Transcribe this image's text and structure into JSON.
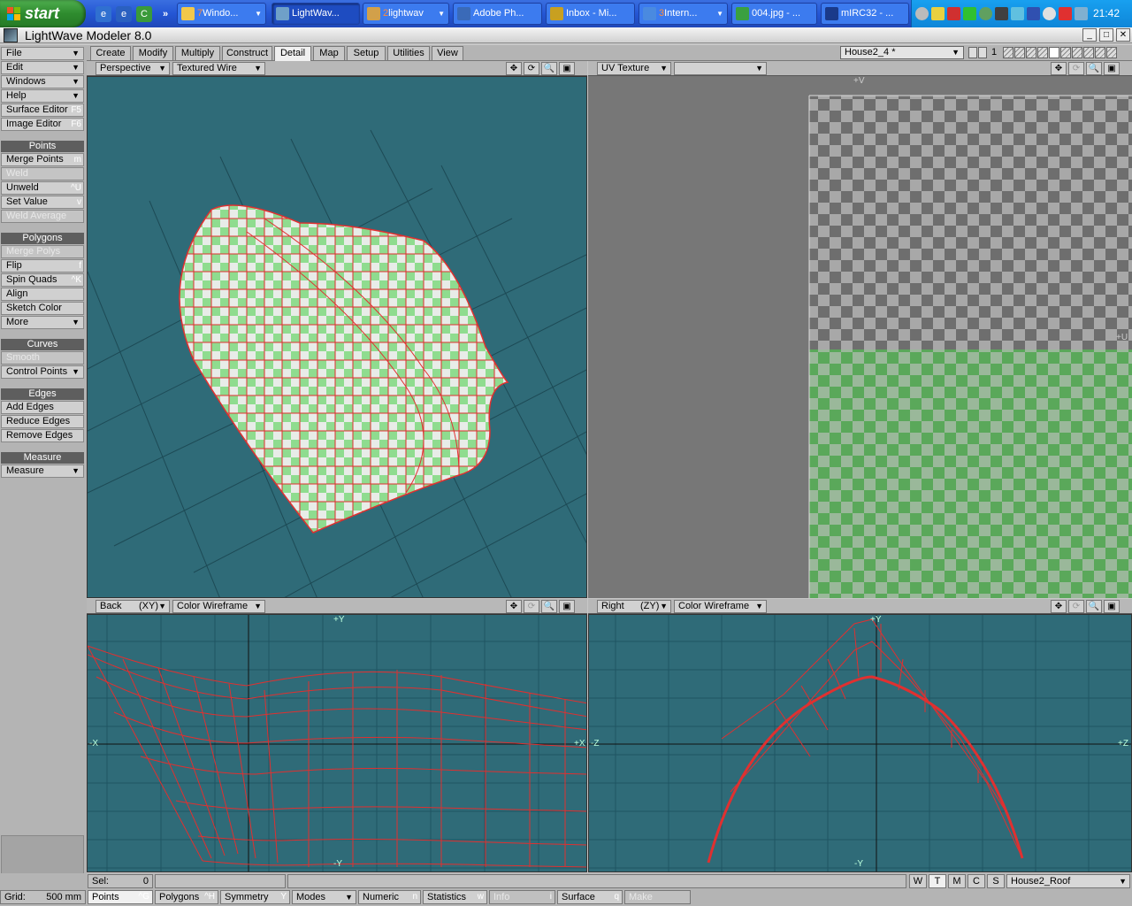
{
  "taskbar": {
    "start_label": "start",
    "buttons": [
      {
        "count": "7",
        "label": "Windo...",
        "icon_color": "#f2c84b"
      },
      {
        "count": "",
        "label": "LightWav...",
        "icon_color": "#6fa0c8"
      },
      {
        "count": "2",
        "label": "lightwav",
        "icon_color": "#d2a04a"
      },
      {
        "count": "",
        "label": "Adobe Ph...",
        "icon_color": "#3a6ab8"
      },
      {
        "count": "",
        "label": "Inbox - Mi...",
        "icon_color": "#c8a020"
      },
      {
        "count": "3",
        "label": "Intern...",
        "icon_color": "#4a8ae0"
      },
      {
        "count": "",
        "label": "004.jpg - ...",
        "icon_color": "#3aa040"
      },
      {
        "count": "",
        "label": "mIRC32 - ...",
        "icon_color": "#1a3a8a"
      }
    ],
    "clock": "21:42"
  },
  "window": {
    "title": "LightWave Modeler 8.0"
  },
  "sidebar": {
    "top_menus": [
      {
        "label": "File",
        "key": ""
      },
      {
        "label": "Edit",
        "key": ""
      },
      {
        "label": "Windows",
        "key": ""
      },
      {
        "label": "Help",
        "key": ""
      },
      {
        "label": "Surface Editor",
        "key": "F5"
      },
      {
        "label": "Image Editor",
        "key": "F6"
      }
    ],
    "points_header": "Points",
    "points": [
      {
        "label": "Merge Points",
        "key": "m"
      },
      {
        "label": "Weld",
        "key": ""
      },
      {
        "label": "Unweld",
        "key": "^U"
      },
      {
        "label": "Set Value",
        "key": "v"
      },
      {
        "label": "Weld Average",
        "key": ""
      }
    ],
    "polygons_header": "Polygons",
    "polygons": [
      {
        "label": "Merge Polys",
        "key": ""
      },
      {
        "label": "Flip",
        "key": "f"
      },
      {
        "label": "Spin Quads",
        "key": "^K"
      },
      {
        "label": "Align",
        "key": ""
      },
      {
        "label": "Sketch Color",
        "key": ""
      },
      {
        "label": "More",
        "key": ""
      }
    ],
    "curves_header": "Curves",
    "curves": [
      {
        "label": "Smooth",
        "key": ""
      },
      {
        "label": "Control Points",
        "key": ""
      }
    ],
    "edges_header": "Edges",
    "edges": [
      {
        "label": "Add Edges",
        "key": ""
      },
      {
        "label": "Reduce Edges",
        "key": ""
      },
      {
        "label": "Remove Edges",
        "key": ""
      }
    ],
    "measure_header": "Measure",
    "measure": [
      {
        "label": "Measure",
        "key": ""
      }
    ]
  },
  "tabs": [
    "Create",
    "Modify",
    "Multiply",
    "Construct",
    "Detail",
    "Map",
    "Setup",
    "Utilities",
    "View"
  ],
  "active_tab": "Detail",
  "object_selector": "House2_4 *",
  "layer_number": "1",
  "viewports": {
    "top_left": {
      "view": "Perspective",
      "mode": "Textured Wire"
    },
    "top_right": {
      "view": "UV Texture",
      "mode": "",
      "axis_v": "+V",
      "axis_u": "+U"
    },
    "bottom_left": {
      "view": "Back",
      "axis": "(XY)",
      "mode": "Color Wireframe",
      "axis_y": "+Y",
      "axis_x_neg": "-X",
      "axis_x_pos": "+X",
      "axis_y_neg": "-Y"
    },
    "bottom_right": {
      "view": "Right",
      "axis": "(ZY)",
      "mode": "Color Wireframe",
      "axis_y": "+Y",
      "axis_z_neg": "-Z",
      "axis_z_pos": "+Z",
      "axis_y_neg": "-Y"
    }
  },
  "status": {
    "sel_label": "Sel:",
    "sel_value": "0",
    "grid_label": "Grid:",
    "grid_value": "500 mm"
  },
  "wtmcs": [
    "W",
    "T",
    "M",
    "C",
    "S"
  ],
  "wtmcs_active": "T",
  "surface_selector": "House2_Roof",
  "bottom_buttons": [
    {
      "label": "Points",
      "key": "^G"
    },
    {
      "label": "Polygons",
      "key": "^H"
    },
    {
      "label": "Symmetry",
      "key": "Y"
    },
    {
      "label": "Modes",
      "key": ""
    },
    {
      "label": "Numeric",
      "key": "n"
    },
    {
      "label": "Statistics",
      "key": "w"
    },
    {
      "label": "Info",
      "key": "i"
    },
    {
      "label": "Surface",
      "key": "q"
    },
    {
      "label": "Make",
      "key": ""
    }
  ],
  "colors": {
    "viewport_bg": "#2f6b78",
    "wire": "#e03030",
    "checker_green": "#6fc86f"
  }
}
